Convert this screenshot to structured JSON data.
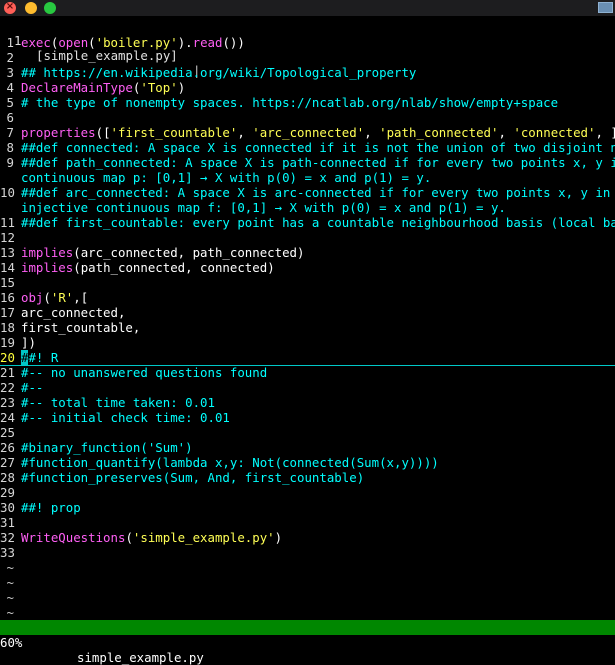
{
  "tab": {
    "number": "1",
    "name": "[simple_example.py]",
    "separator": "|"
  },
  "icons": [
    "close-icon",
    "minimize-icon",
    "zoom-icon",
    "window-icon"
  ],
  "colors": {
    "function": "#ff5ff5",
    "string": "#ffff55",
    "comment": "#00ffff",
    "status_bg": "#008700",
    "cursor": "#00c7c7",
    "current_line_number": "#ffff3c"
  },
  "lines": [
    {
      "n": "1",
      "segs": [
        [
          "fn",
          "exec"
        ],
        [
          "wh",
          "("
        ],
        [
          "fn",
          "open"
        ],
        [
          "wh",
          "("
        ],
        [
          "str",
          "'boiler.py'"
        ],
        [
          "wh",
          ")."
        ],
        [
          "fn",
          "read"
        ],
        [
          "wh",
          "())"
        ]
      ]
    },
    {
      "n": "2",
      "segs": []
    },
    {
      "n": "3",
      "segs": [
        [
          "cm",
          "## https://en.wikipedia.org/wiki/Topological_property"
        ]
      ]
    },
    {
      "n": "4",
      "segs": [
        [
          "fn",
          "DeclareMainType"
        ],
        [
          "wh",
          "("
        ],
        [
          "str",
          "'Top'"
        ],
        [
          "wh",
          ")"
        ]
      ]
    },
    {
      "n": "5",
      "segs": [
        [
          "cm",
          "# the type of nonempty spaces. https://ncatlab.org/nlab/show/empty+space"
        ]
      ]
    },
    {
      "n": "6",
      "segs": []
    },
    {
      "n": "7",
      "segs": [
        [
          "fn",
          "properties"
        ],
        [
          "wh",
          "(["
        ],
        [
          "str",
          "'first_countable'"
        ],
        [
          "wh",
          ", "
        ],
        [
          "str",
          "'arc_connected'"
        ],
        [
          "wh",
          ", "
        ],
        [
          "str",
          "'path_connected'"
        ],
        [
          "wh",
          ", "
        ],
        [
          "str",
          "'connected'"
        ],
        [
          "wh",
          ", ])"
        ]
      ]
    },
    {
      "n": "8",
      "segs": [
        [
          "cm",
          "##def connected: A space X is connected if it is not the union of two disjoint non-em"
        ]
      ]
    },
    {
      "n": "9",
      "segs": [
        [
          "cm",
          "##def path_connected: A space X is path-connected if for every two points x, y in X,"
        ]
      ]
    },
    {
      "n": "",
      "segs": [
        [
          "cm",
          "continuous map p: [0,1] → X with p(0) = x and p(1) = y."
        ]
      ]
    },
    {
      "n": "10",
      "segs": [
        [
          "cm",
          "##def arc_connected: A space X is arc-connected if for every two points x, y in X, th"
        ]
      ]
    },
    {
      "n": "",
      "segs": [
        [
          "cm",
          "injective continuous map f: [0,1] → X with p(0) = x and p(1) = y."
        ]
      ]
    },
    {
      "n": "11",
      "segs": [
        [
          "cm",
          "##def first_countable: every point has a countable neighbourhood basis (local base)"
        ]
      ]
    },
    {
      "n": "12",
      "segs": []
    },
    {
      "n": "13",
      "segs": [
        [
          "fn",
          "implies"
        ],
        [
          "wh",
          "("
        ],
        [
          "wh",
          "arc_connected, path_connected"
        ],
        [
          "wh",
          ")"
        ]
      ]
    },
    {
      "n": "14",
      "segs": [
        [
          "fn",
          "implies"
        ],
        [
          "wh",
          "("
        ],
        [
          "wh",
          "path_connected, connected"
        ],
        [
          "wh",
          ")"
        ]
      ]
    },
    {
      "n": "15",
      "segs": []
    },
    {
      "n": "16",
      "segs": [
        [
          "fn",
          "obj"
        ],
        [
          "wh",
          "("
        ],
        [
          "str",
          "'R'"
        ],
        [
          "wh",
          ",["
        ]
      ]
    },
    {
      "n": "17",
      "segs": [
        [
          "wh",
          "arc_connected,"
        ]
      ]
    },
    {
      "n": "18",
      "segs": [
        [
          "wh",
          "first_countable,"
        ]
      ]
    },
    {
      "n": "19",
      "segs": [
        [
          "wh",
          "])"
        ]
      ]
    },
    {
      "n": "20",
      "cur": true,
      "segs": [
        [
          "cursor",
          "#"
        ],
        [
          "cm",
          "#! R"
        ]
      ]
    },
    {
      "n": "21",
      "segs": [
        [
          "cm",
          "#-- no unanswered questions found"
        ]
      ]
    },
    {
      "n": "22",
      "segs": [
        [
          "cm",
          "#--"
        ]
      ]
    },
    {
      "n": "23",
      "segs": [
        [
          "cm",
          "#-- total time taken: 0.01"
        ]
      ]
    },
    {
      "n": "24",
      "segs": [
        [
          "cm",
          "#-- initial check time: 0.01"
        ]
      ]
    },
    {
      "n": "25",
      "segs": []
    },
    {
      "n": "26",
      "segs": [
        [
          "cm",
          "#binary_function('Sum')"
        ]
      ]
    },
    {
      "n": "27",
      "segs": [
        [
          "cm",
          "#function_quantify(lambda x,y: Not(connected(Sum(x,y))))"
        ]
      ]
    },
    {
      "n": "28",
      "segs": [
        [
          "cm",
          "#function_preserves(Sum, And, first_countable)"
        ]
      ]
    },
    {
      "n": "29",
      "segs": []
    },
    {
      "n": "30",
      "segs": [
        [
          "cm",
          "##! prop"
        ]
      ]
    },
    {
      "n": "31",
      "segs": []
    },
    {
      "n": "32",
      "segs": [
        [
          "fn",
          "WriteQuestions"
        ],
        [
          "wh",
          "("
        ],
        [
          "str",
          "'simple_example.py'"
        ],
        [
          "wh",
          ")"
        ]
      ]
    },
    {
      "n": "33",
      "segs": []
    },
    {
      "n": "~",
      "tilde": true,
      "segs": []
    },
    {
      "n": "~",
      "tilde": true,
      "segs": []
    },
    {
      "n": "~",
      "tilde": true,
      "segs": []
    },
    {
      "n": "~",
      "tilde": true,
      "segs": []
    }
  ],
  "status": {
    "percent": "60%",
    "filename": "simple_example.py"
  }
}
